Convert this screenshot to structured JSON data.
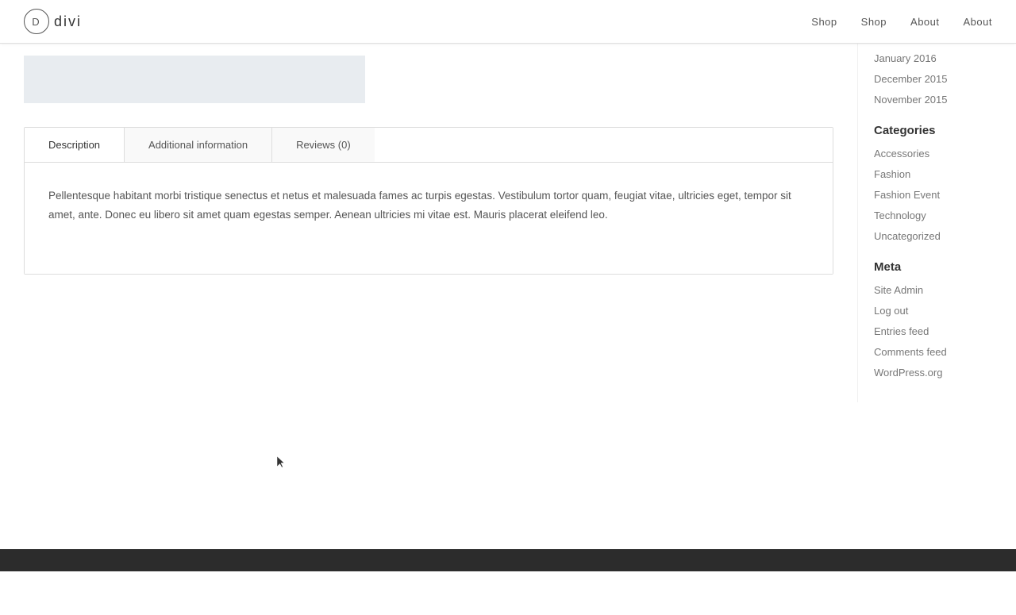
{
  "header": {
    "logo_letter": "D",
    "logo_text": "divi",
    "nav_items": [
      {
        "label": "Shop"
      },
      {
        "label": "Shop"
      },
      {
        "label": "About"
      },
      {
        "label": "About"
      }
    ]
  },
  "tabs": {
    "items": [
      {
        "label": "Description",
        "active": true
      },
      {
        "label": "Additional information",
        "active": false
      },
      {
        "label": "Reviews (0)",
        "active": false
      }
    ],
    "content": "Pellentesque habitant morbi tristique senectus et netus et malesuada fames ac turpis egestas. Vestibulum tortor quam, feugiat vitae, ultricies eget, tempor sit amet, ante. Donec eu libero sit amet quam egestas semper. Aenean ultricies mi vitae est. Mauris placerat eleifend leo."
  },
  "sidebar": {
    "archive_title": "",
    "archive_items": [
      {
        "label": "January 2016"
      },
      {
        "label": "December 2015"
      },
      {
        "label": "November 2015"
      }
    ],
    "categories_title": "Categories",
    "categories": [
      {
        "label": "Accessories"
      },
      {
        "label": "Fashion"
      },
      {
        "label": "Fashion Event"
      },
      {
        "label": "Technology"
      },
      {
        "label": "Uncategorized"
      }
    ],
    "meta_title": "Meta",
    "meta_items": [
      {
        "label": "Site Admin"
      },
      {
        "label": "Log out"
      },
      {
        "label": "Entries feed"
      },
      {
        "label": "Comments feed"
      },
      {
        "label": "WordPress.org"
      }
    ]
  }
}
